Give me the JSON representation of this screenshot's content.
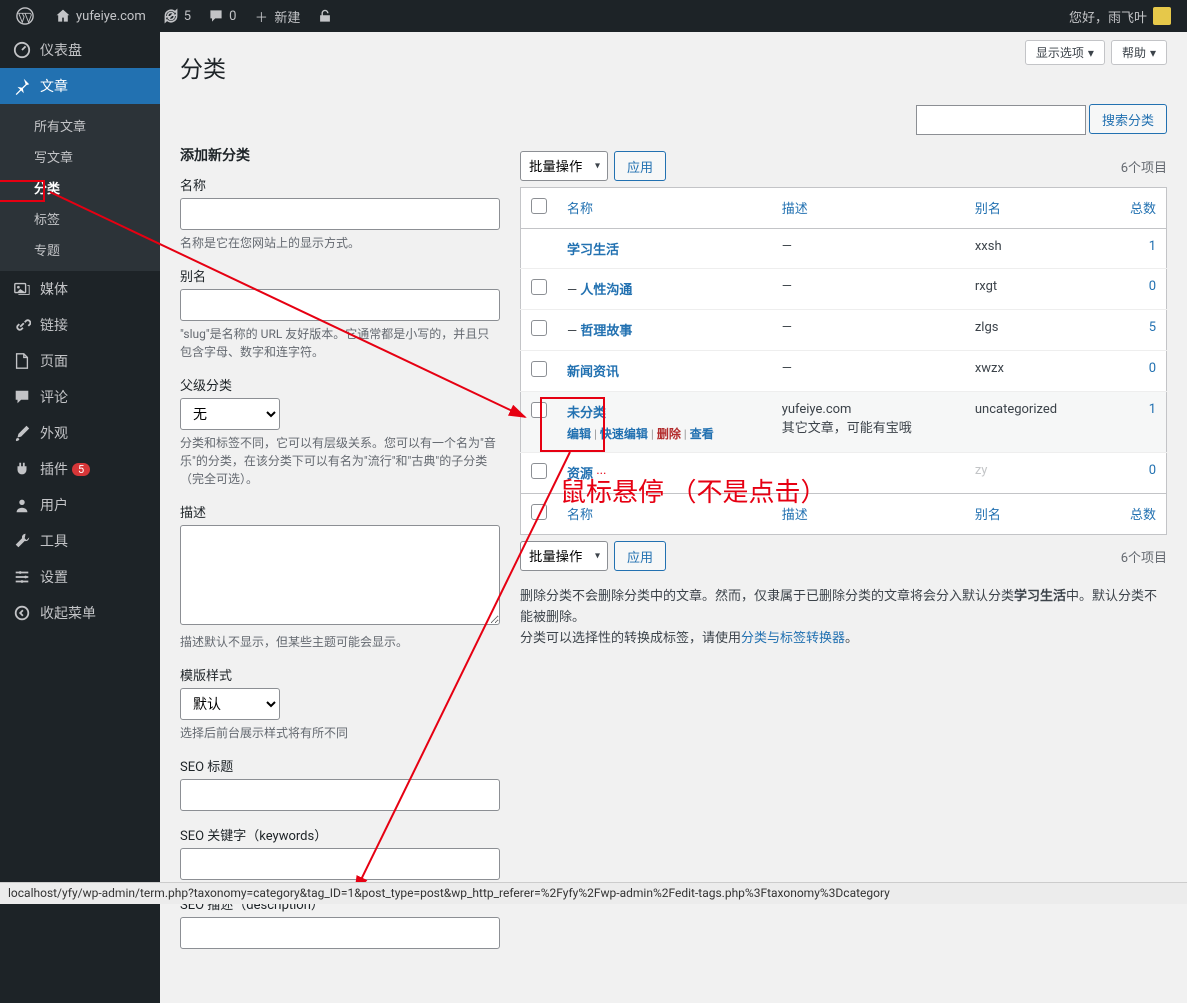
{
  "adminbar": {
    "site_name": "yufeiye.com",
    "updates": "5",
    "comments": "0",
    "new": "新建",
    "greeting": "您好，雨飞叶"
  },
  "sidebar": {
    "dashboard": "仪表盘",
    "posts": "文章",
    "posts_sub": {
      "all": "所有文章",
      "new": "写文章",
      "cat": "分类",
      "tag": "标签",
      "topic": "专题"
    },
    "media": "媒体",
    "links": "链接",
    "pages": "页面",
    "comments": "评论",
    "appearance": "外观",
    "plugins": "插件",
    "plugins_badge": "5",
    "users": "用户",
    "tools": "工具",
    "settings": "设置",
    "collapse": "收起菜单"
  },
  "screen": {
    "options": "显示选项",
    "help": "帮助"
  },
  "page": {
    "title": "分类",
    "search_btn": "搜索分类"
  },
  "form": {
    "heading": "添加新分类",
    "name_label": "名称",
    "name_desc": "名称是它在您网站上的显示方式。",
    "slug_label": "别名",
    "slug_desc": "\"slug\"是名称的 URL 友好版本。它通常都是小写的，并且只包含字母、数字和连字符。",
    "parent_label": "父级分类",
    "parent_option": "无",
    "parent_desc": "分类和标签不同，它可以有层级关系。您可以有一个名为\"音乐\"的分类，在该分类下可以有名为\"流行\"和\"古典\"的子分类（完全可选）。",
    "desc_label": "描述",
    "desc_desc": "描述默认不显示，但某些主题可能会显示。",
    "template_label": "模版样式",
    "template_option": "默认",
    "template_desc": "选择后前台展示样式将有所不同",
    "seo_title": "SEO 标题",
    "seo_keywords": "SEO 关键字（keywords）",
    "seo_desc": "SEO 描述（description）"
  },
  "list": {
    "bulk": "批量操作",
    "apply": "应用",
    "count_text": "6个项目",
    "cols": {
      "name": "名称",
      "desc": "描述",
      "slug": "别名",
      "count": "总数"
    },
    "rows": [
      {
        "name": "学习生活",
        "indent": "",
        "desc": "—",
        "slug": "xxsh",
        "count": "1",
        "cb": false
      },
      {
        "name": "人性沟通",
        "indent": "— ",
        "desc": "—",
        "slug": "rxgt",
        "count": "0",
        "cb": true
      },
      {
        "name": "哲理故事",
        "indent": "— ",
        "desc": "—",
        "slug": "zlgs",
        "count": "5",
        "cb": true
      },
      {
        "name": "新闻资讯",
        "indent": "",
        "desc": "—",
        "slug": "xwzx",
        "count": "0",
        "cb": true
      },
      {
        "name": "未分类",
        "indent": "",
        "desc": "yufeiye.com\n其它文章，可能有宝哦",
        "slug": "uncategorized",
        "count": "1",
        "cb": true,
        "hovered": true
      },
      {
        "name": "资源",
        "indent": "",
        "desc": "",
        "slug": "zy",
        "count": "0",
        "cb": true,
        "obscured": true
      }
    ],
    "actions": {
      "edit": "编辑",
      "quick": "快速编辑",
      "del": "删除",
      "view": "查看"
    }
  },
  "footer_note": {
    "p1_a": "删除分类不会删除分类中的文章。然而，仅隶属于已删除分类的文章将会分入默认分类",
    "p1_b": "学习生活",
    "p1_c": "中。默认分类不能被删除。",
    "p2_a": "分类可以选择性的转换成标签，请使用",
    "p2_link": "分类与标签转换器",
    "p2_b": "。"
  },
  "annotation": {
    "hover_text": "鼠标悬停 （不是点击）"
  },
  "status_url": "localhost/yfy/wp-admin/term.php?taxonomy=category&tag_ID=1&post_type=post&wp_http_referer=%2Fyfy%2Fwp-admin%2Fedit-tags.php%3Ftaxonomy%3Dcategory"
}
